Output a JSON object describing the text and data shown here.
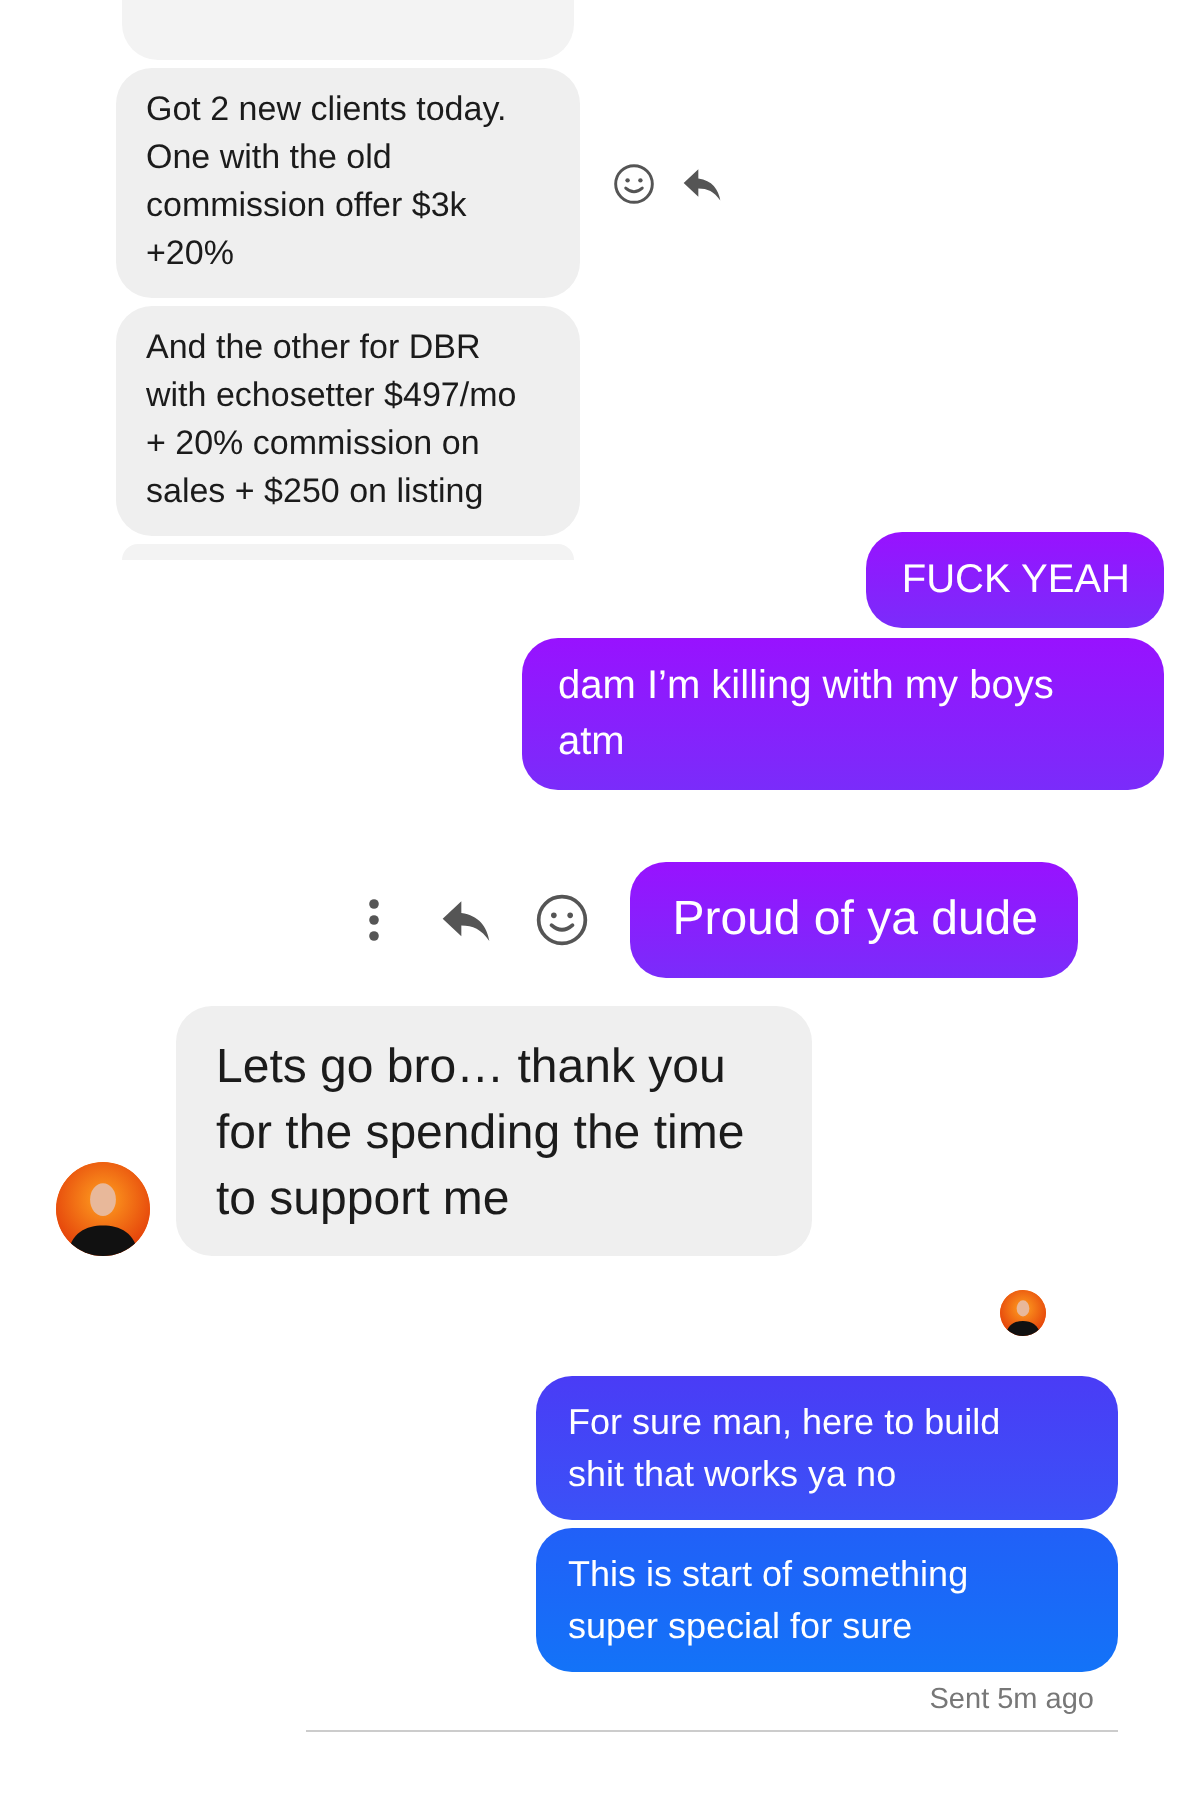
{
  "sections": [
    {
      "kind": "incoming",
      "messages": [
        {
          "kind": "cut_top"
        },
        {
          "kind": "text",
          "text": "Got 2 new clients today. One with the old commission offer $3k +20%",
          "show_actions": true
        },
        {
          "kind": "text",
          "text": "And the other for DBR with echosetter $497/mo + 20% commission on sales + $250 on listing",
          "show_actions": false
        },
        {
          "kind": "cut_bottom"
        }
      ]
    },
    {
      "kind": "outgoing",
      "messages": [
        {
          "kind": "text",
          "text": "FUCK YEAH",
          "show_actions": false
        },
        {
          "kind": "text",
          "text": "dam I’m killing with my boys atm",
          "show_actions": false
        }
      ]
    },
    {
      "kind": "outgoing",
      "messages": [
        {
          "kind": "text",
          "text": "Proud of ya dude",
          "show_actions": true
        }
      ]
    },
    {
      "kind": "incoming",
      "avatar": true,
      "messages": [
        {
          "kind": "text",
          "text": "Lets go bro… thank you for the spending the time to support me",
          "show_actions": false
        }
      ]
    },
    {
      "kind": "read_receipt"
    },
    {
      "kind": "outgoing",
      "status": "Sent 5m ago",
      "messages": [
        {
          "kind": "text",
          "text": "For sure man, here to build shit that works ya no",
          "show_actions": false
        },
        {
          "kind": "text",
          "text": "This is start of something super special for sure",
          "show_actions": false
        }
      ]
    }
  ]
}
